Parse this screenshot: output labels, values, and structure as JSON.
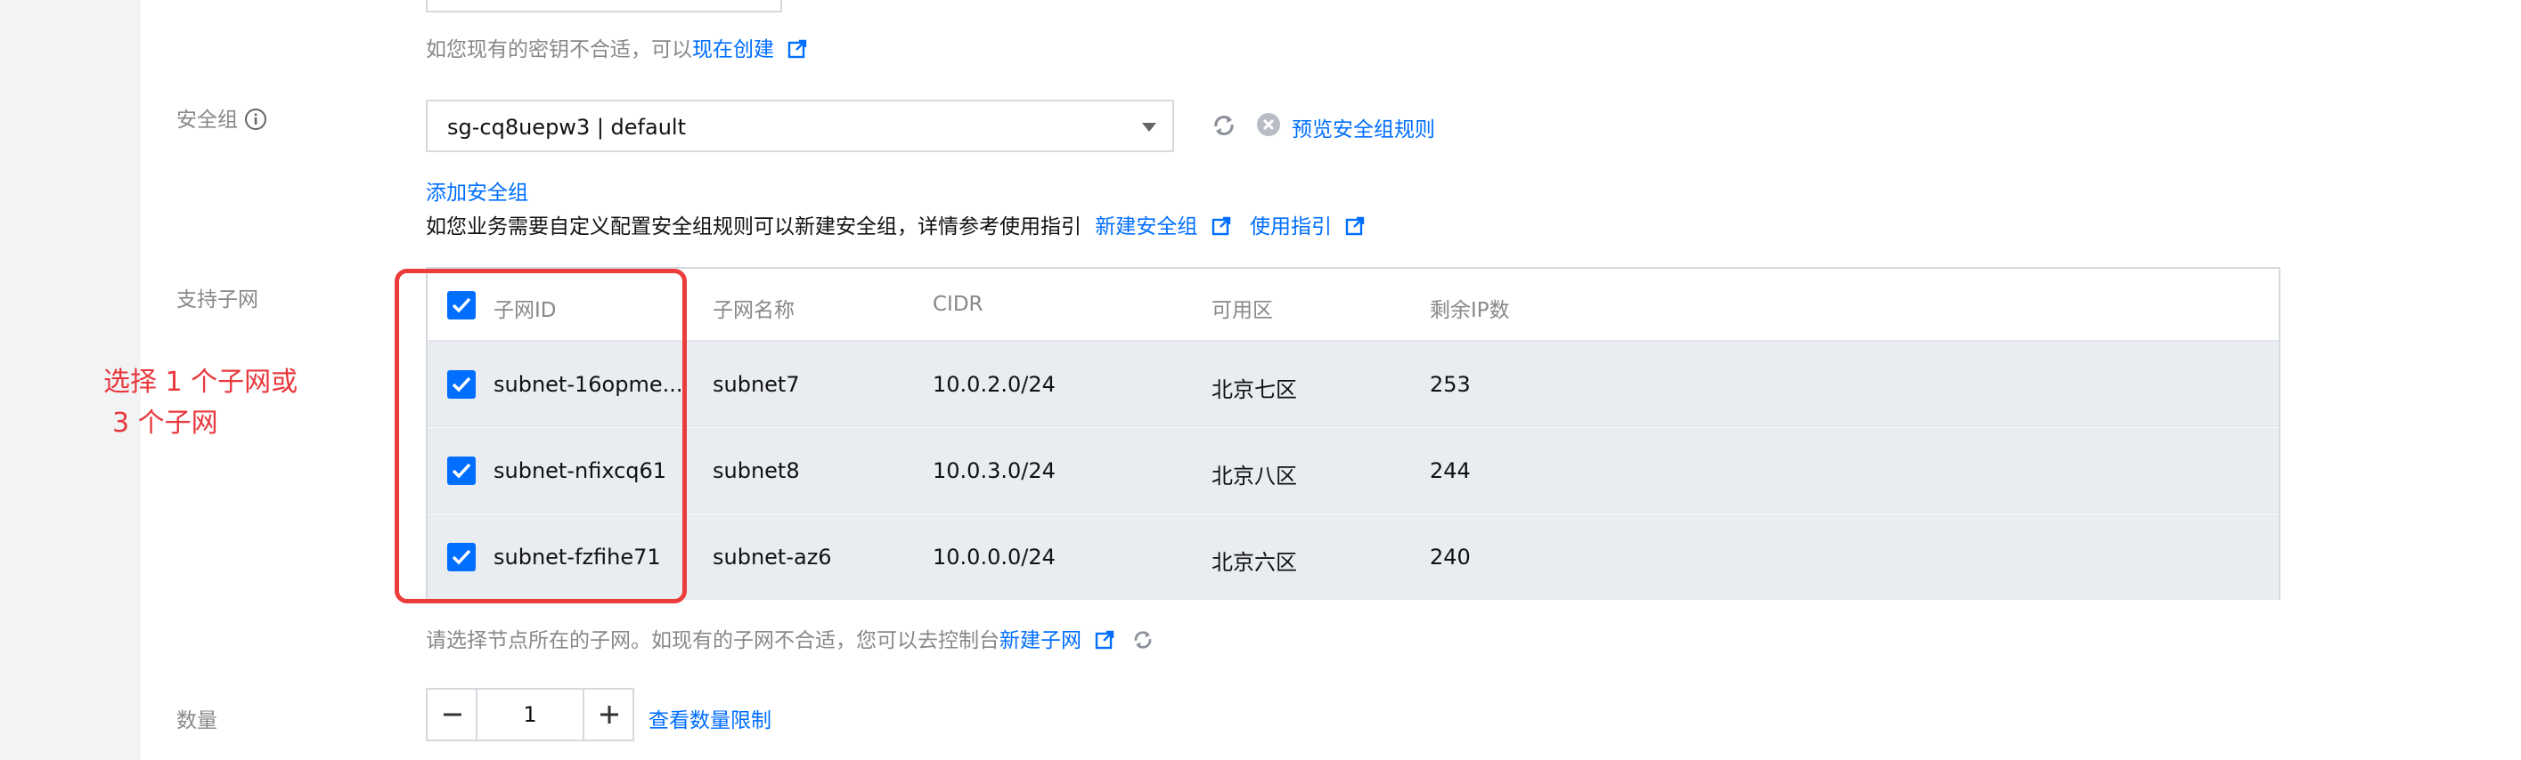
{
  "key_hint": {
    "text": "如您现有的密钥不合适，可以",
    "link": "现在创建"
  },
  "security_group": {
    "label": "安全组",
    "selected": "sg-cq8uepw3 | default",
    "preview_link": "预览安全组规则",
    "add_link": "添加安全组",
    "desc": "如您业务需要自定义配置安全组规则可以新建安全组，详情参考使用指引",
    "new_link": "新建安全组",
    "guide_link": "使用指引"
  },
  "subnet": {
    "label": "支持子网",
    "columns": [
      "子网ID",
      "子网名称",
      "CIDR",
      "可用区",
      "剩余IP数"
    ],
    "rows": [
      {
        "id": "subnet-16opme...",
        "name": "subnet7",
        "cidr": "10.0.2.0/24",
        "zone": "北京七区",
        "ips": "253",
        "checked": true
      },
      {
        "id": "subnet-nfixcq61",
        "name": "subnet8",
        "cidr": "10.0.3.0/24",
        "zone": "北京八区",
        "ips": "244",
        "checked": true
      },
      {
        "id": "subnet-fzfihe71",
        "name": "subnet-az6",
        "cidr": "10.0.0.0/24",
        "zone": "北京六区",
        "ips": "240",
        "checked": true
      }
    ],
    "hint": "请选择节点所在的子网。如现有的子网不合适，您可以去控制台",
    "new_link": "新建子网"
  },
  "quantity": {
    "label": "数量",
    "value": "1",
    "limit_link": "查看数量限制"
  },
  "annotation": {
    "line1": "选择 1 个子网或",
    "line2": "3 个子网"
  },
  "colors": {
    "accent": "#006eff",
    "annotation": "#e8383d",
    "row_bg": "#e9ecf0"
  },
  "icons": [
    "external-link-icon",
    "refresh-icon",
    "close-circle-icon",
    "info-icon",
    "check-icon",
    "minus-icon",
    "plus-icon"
  ]
}
